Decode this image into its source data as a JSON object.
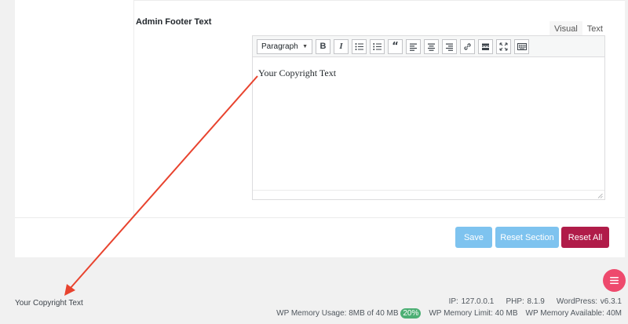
{
  "field": {
    "label": "Admin Footer Text"
  },
  "editor_tabs": {
    "visual": "Visual",
    "text": "Text"
  },
  "toolbar": {
    "format_select": "Paragraph"
  },
  "editor": {
    "content": "Your Copyright Text"
  },
  "buttons": {
    "save": "Save",
    "reset_section": "Reset Section",
    "reset_all": "Reset All"
  },
  "footer": {
    "left_text": "Your Copyright Text",
    "ip": "IP: 127.0.0.1",
    "php": "PHP: 8.1.9",
    "wordpress": "WordPress: v6.3.1",
    "memory_usage": "WP Memory Usage: 8MB of 40 MB",
    "memory_percent": "20%",
    "memory_limit": "WP Memory Limit: 40 MB",
    "memory_available": "WP Memory Available: 40M"
  },
  "colors": {
    "primary_button": "#7ec3ef",
    "danger_button": "#b01c49",
    "fab": "#ee4a6d",
    "annotation_arrow": "#e8432e",
    "memory_badge": "#4caf74"
  }
}
